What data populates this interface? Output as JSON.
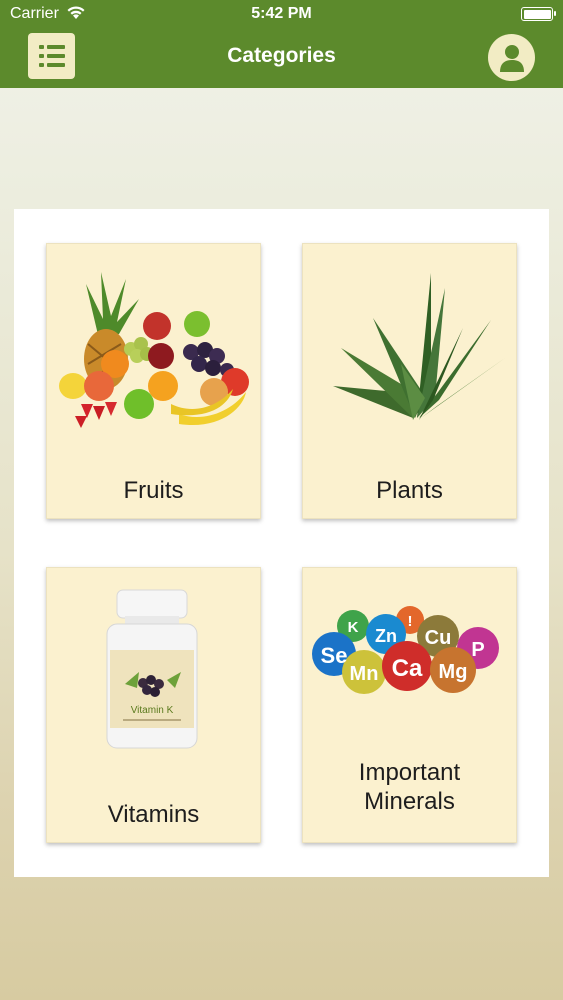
{
  "status_bar": {
    "carrier": "Carrier",
    "time": "5:42 PM"
  },
  "header": {
    "title": "Categories",
    "bg_color": "#5c8a2c",
    "menu_icon": "list-icon",
    "profile_icon": "user-icon"
  },
  "categories": [
    {
      "label": "Fruits",
      "image": "fruits-image"
    },
    {
      "label": "Plants",
      "image": "aloe-vera-image"
    },
    {
      "label": "Vitamins",
      "image": "vitamin-bottle-image",
      "bottle_label": "Vitamin K"
    },
    {
      "label_line1": "Important",
      "label_line2": "Minerals",
      "image": "minerals-spheres-image",
      "minerals": [
        "Se",
        "K",
        "Zn",
        "!",
        "Cu",
        "P",
        "Mn",
        "Ca",
        "Mg"
      ]
    }
  ]
}
